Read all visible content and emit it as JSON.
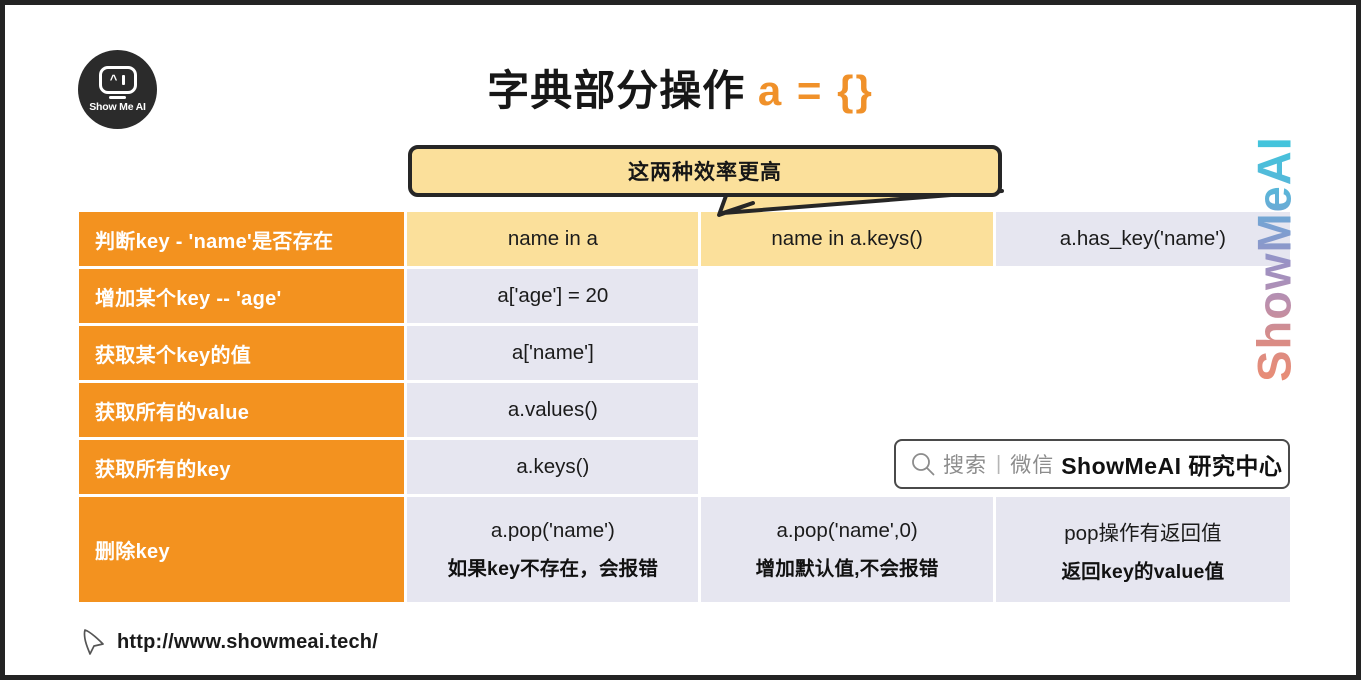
{
  "logo": {
    "name": "Show Me AI",
    "text": "Show Me AI"
  },
  "title": {
    "main": "字典部分操作",
    "code": "a = {}"
  },
  "callout": {
    "text": "这两种效率更高"
  },
  "table": {
    "rows": [
      {
        "label": "判断key - 'name'是否存在",
        "c2": "name in a",
        "c2_highlight": true,
        "c3": "name in a.keys()",
        "c3_highlight": true,
        "c4": "a.has_key('name')",
        "c4_highlight": false
      },
      {
        "label": "增加某个key -- 'age'",
        "c2": "a['age'] = 20",
        "c2_highlight": false,
        "c3": "",
        "c4": ""
      },
      {
        "label": "获取某个key的值",
        "c2": "a['name']",
        "c2_highlight": false,
        "c3": "",
        "c4": ""
      },
      {
        "label": "获取所有的value",
        "c2": "a.values()",
        "c2_highlight": false,
        "c3": "",
        "c4": ""
      },
      {
        "label": "获取所有的key",
        "c2": "a.keys()",
        "c2_highlight": false,
        "c3": "",
        "c4": ""
      },
      {
        "label": "删除key",
        "c2": "a.pop('name')",
        "c2_sub": "如果key不存在，会报错",
        "c3": "a.pop('name',0)",
        "c3_sub": "增加默认值,不会报错",
        "c4": "pop操作有返回值",
        "c4_sub": "返回key的value值"
      }
    ]
  },
  "watermark": {
    "text": "ShowMeAI"
  },
  "search": {
    "placeholder": "搜索",
    "divider": "|",
    "channel": "微信",
    "account": "ShowMeAI 研究中心"
  },
  "footer": {
    "url": "http://www.showmeai.tech/"
  },
  "colors": {
    "orange": "#F3921F",
    "lavender": "#E6E6F0",
    "yellow": "#FBE09B",
    "border": "#232323",
    "title_accent": "#F0912A"
  }
}
